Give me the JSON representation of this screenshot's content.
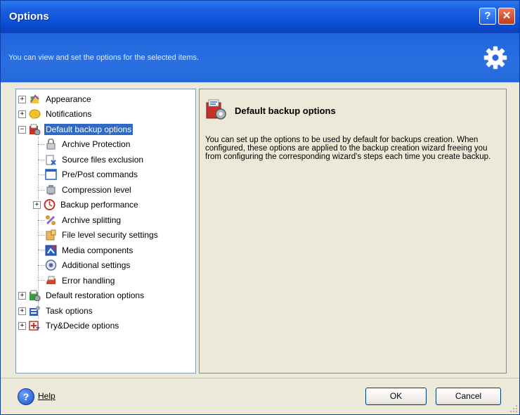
{
  "window": {
    "title": "Options",
    "help_glyph": "?",
    "close_glyph": "✕"
  },
  "banner": {
    "text": "You can view and set the options for the selected items.",
    "icon": "gear-icon"
  },
  "tree": {
    "items": [
      {
        "label": "Appearance",
        "icon": "appearance-icon",
        "expander": "+"
      },
      {
        "label": "Notifications",
        "icon": "notifications-icon",
        "expander": "+"
      },
      {
        "label": "Default backup options",
        "icon": "backup-options-icon",
        "expander": "−",
        "selected": true
      },
      {
        "label": "Archive Protection",
        "icon": "lock-icon"
      },
      {
        "label": "Source files exclusion",
        "icon": "file-exclusion-icon"
      },
      {
        "label": "Pre/Post commands",
        "icon": "commands-icon"
      },
      {
        "label": "Compression level",
        "icon": "compression-icon"
      },
      {
        "label": "Backup performance",
        "icon": "performance-icon",
        "expander": "+"
      },
      {
        "label": "Archive splitting",
        "icon": "splitting-icon"
      },
      {
        "label": "File level security settings",
        "icon": "security-icon"
      },
      {
        "label": "Media components",
        "icon": "media-icon"
      },
      {
        "label": "Additional settings",
        "icon": "additional-settings-icon"
      },
      {
        "label": "Error handling",
        "icon": "error-icon"
      },
      {
        "label": "Default restoration options",
        "icon": "restoration-icon",
        "expander": "+"
      },
      {
        "label": "Task options",
        "icon": "task-icon",
        "expander": "+"
      },
      {
        "label": "Try&Decide options",
        "icon": "try-decide-icon",
        "expander": "+"
      }
    ]
  },
  "panel": {
    "title": "Default backup options",
    "description": "You can set up the options to be used by default for backups creation. When configured, these options are applied to the backup creation wizard freeing you from configuring the corresponding wizard's steps each time you create backup."
  },
  "footer": {
    "help_label": "Help",
    "help_glyph": "?",
    "ok_label": "OK",
    "cancel_label": "Cancel"
  },
  "colors": {
    "title_bar": "#0a4fd6",
    "selection": "#316ac5",
    "dialog_bg": "#ece9d8"
  }
}
